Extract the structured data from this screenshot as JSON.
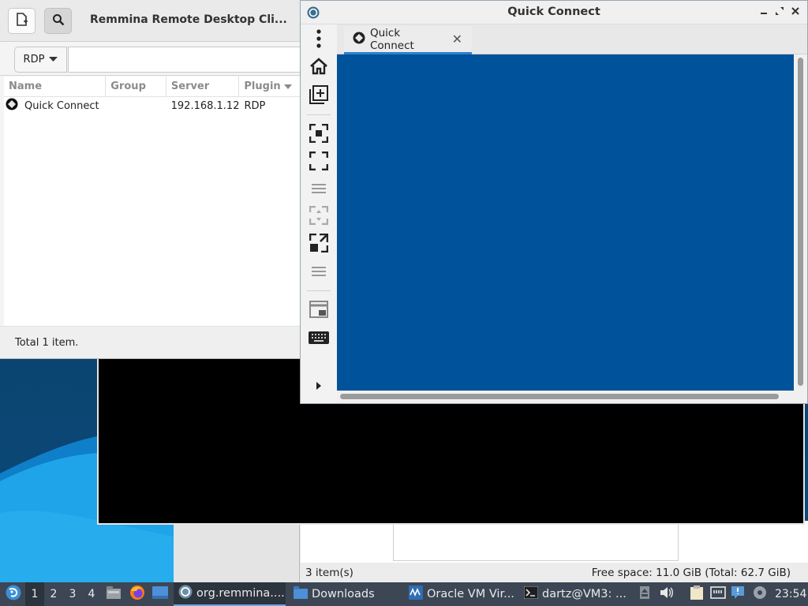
{
  "desktop": {
    "wallpaper_colors": [
      "#0a3b63",
      "#0f7fc9",
      "#1fa4ea"
    ]
  },
  "remmina_main": {
    "title": "Remmina Remote Desktop Cli...",
    "new_connection_icon": "new-connection-icon",
    "search_icon": "search-icon",
    "protocol": "RDP",
    "server_input_value": "",
    "columns": [
      "Name",
      "Group",
      "Server",
      "Plugin"
    ],
    "rows": [
      {
        "name": "Quick Connect",
        "group": "",
        "server": "192.168.1.12",
        "plugin": "RDP"
      }
    ],
    "status": "Total 1 item."
  },
  "quick_connect": {
    "title": "Quick Connect",
    "tab_label": "Quick Connect",
    "remote_color": "#00529b",
    "toolbar_icons": [
      "menu-icon",
      "home-icon",
      "duplicate-icon",
      "fit-window-icon",
      "fullscreen-icon",
      "dynamic-resolution-icon",
      "scaled-mode-icon",
      "multi-monitor-icon",
      "grab-keyboard-icon",
      "send-keys-icon",
      "expand-icon"
    ]
  },
  "file_manager": {
    "status_items": "3 item(s)",
    "status_space": "Free space: 11.0 GiB (Total: 62.7 GiB)"
  },
  "taskbar": {
    "workspaces": [
      "1",
      "2",
      "3",
      "4"
    ],
    "tasks": [
      {
        "label": "org.remmina....",
        "icon": "remmina-icon"
      },
      {
        "label": "Downloads",
        "icon": "folder-icon"
      },
      {
        "label": "Oracle VM Vir...",
        "icon": "virtualbox-icon"
      },
      {
        "label": "dartz@VM3: ...",
        "icon": "terminal-icon"
      }
    ],
    "clock": "23:54"
  }
}
